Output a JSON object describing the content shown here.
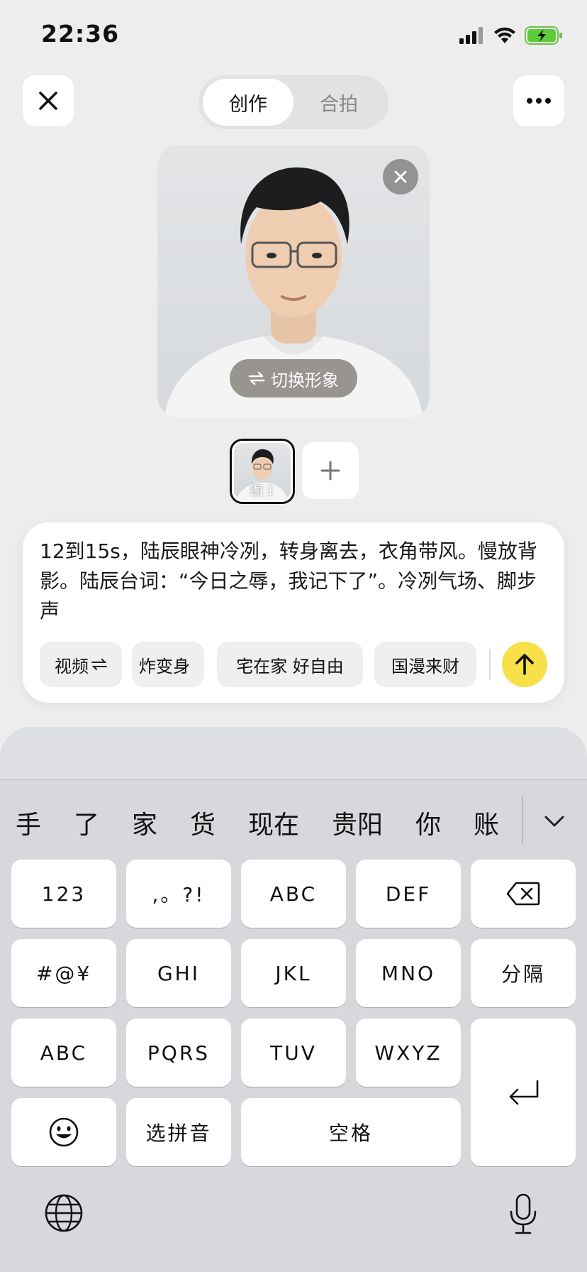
{
  "status_bar": {
    "time": "22:36"
  },
  "header": {
    "tabs": [
      {
        "label": "创作",
        "active": true
      },
      {
        "label": "合拍",
        "active": false
      }
    ]
  },
  "avatar": {
    "switch_label": "切换形象",
    "thumbnail_label": "图 1"
  },
  "composer": {
    "prompt_text": "12到15s，陆辰眼神冷冽，转身离去，衣角带风。慢放背影。陆辰台词：“今日之辱，我记下了”。冷冽气场、脚步声",
    "chips": [
      "视频",
      "炸变身",
      "宅在家 好自由",
      "国漫来财"
    ],
    "accent_color": "#f8e049"
  },
  "keyboard": {
    "candidates": [
      "手",
      "了",
      "家",
      "货",
      "现在",
      "贵阳",
      "你",
      "账"
    ],
    "rows": [
      [
        "123",
        ",。?!",
        "ABC",
        "DEF"
      ],
      [
        "#@¥",
        "GHI",
        "JKL",
        "MNO",
        "分隔"
      ],
      [
        "ABC",
        "PQRS",
        "TUV",
        "WXYZ"
      ],
      [
        "选拼音",
        "空格"
      ]
    ]
  },
  "icons": [
    "close-icon",
    "more-icon",
    "swap-icon",
    "plus-icon",
    "send-arrow-icon",
    "delete-icon",
    "return-icon",
    "emoji-icon",
    "globe-icon",
    "microphone-icon",
    "chevron-down-icon"
  ]
}
